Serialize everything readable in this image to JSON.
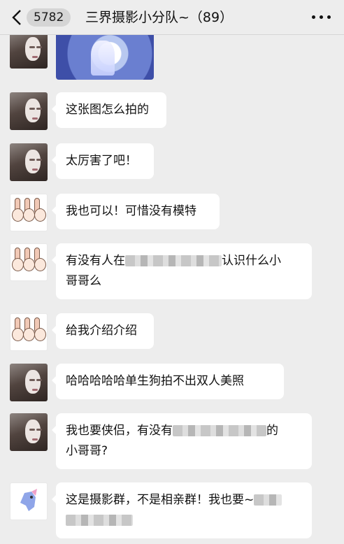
{
  "header": {
    "unread_count": "5782",
    "title": "三界摄影小分队~（89）"
  },
  "colors": {
    "background": "#ededed",
    "bubble": "#ffffff"
  },
  "messages": [
    {
      "sender": "girl",
      "type": "image"
    },
    {
      "sender": "girl",
      "text": "这张图怎么拍的"
    },
    {
      "sender": "girl",
      "text": "太厉害了吧！"
    },
    {
      "sender": "bunny",
      "text": "我也可以！可惜没有模特"
    },
    {
      "sender": "bunny",
      "text_before": "有没有人在",
      "text_after": "认识什么小",
      "text_line2": "哥哥么"
    },
    {
      "sender": "bunny",
      "text": "给我介绍介绍"
    },
    {
      "sender": "girl",
      "text": "哈哈哈哈哈单生狗拍不出双人美照"
    },
    {
      "sender": "girl",
      "text_before": "我也要侠侣，有没有",
      "text_after": "的",
      "text_line2": "小哥哥?"
    },
    {
      "sender": "bird",
      "text_before": "这是摄影群，不是相亲群！我也要~"
    }
  ],
  "icons": {
    "back": "chevron-left-icon",
    "more": "more-dots-icon"
  }
}
